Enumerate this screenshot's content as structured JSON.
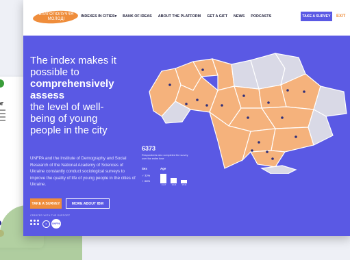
{
  "header": {
    "logo_text": "БЛАГОПОЛУЧЧЯ МОЛОДІ",
    "nav": [
      {
        "label": "INDEXES IN CITIES",
        "has_dropdown": true
      },
      {
        "label": "BANK OF IDEAS"
      },
      {
        "label": "ABOUT THE PLATFORM"
      },
      {
        "label": "GET A GIFT"
      },
      {
        "label": "NEWS"
      },
      {
        "label": "PODCASTS"
      }
    ],
    "take_survey": "TAKE A SURVEY",
    "exit": "EXIT"
  },
  "hero": {
    "line1": "The index makes it",
    "line2": "possible to",
    "line3": "comprehensively",
    "line4": "assess",
    "line5": "the level of well-",
    "line6": "being of young",
    "line7": "people in the city",
    "description": "UNFPA and the Institute of Demography and Social Research of the National Academy of Sciences of Ukraine constantly conduct sociological surveys to improve the quality of life of young people in the cities of Ukraine.",
    "btn_survey": "TAKE A SURVEY",
    "btn_more": "MORE ABOUT IBM",
    "partners_label": "CREATED WITH THE SUPPORT",
    "partner_unfpa": "UNFPA"
  },
  "stats": {
    "respondents": "6373",
    "caption": "Respondents who completed the survey over the entire time",
    "sex_label": "Sex",
    "age_label": "Age",
    "male": "32%",
    "female": "68%",
    "age_groups": [
      {
        "label": "14-17",
        "share": 0.75
      },
      {
        "label": "18-24",
        "share": 0.45
      },
      {
        "label": "25-34",
        "share": 0.3
      }
    ]
  },
  "colors": {
    "brand_purple": "#5a59e4",
    "accent_orange": "#ef8d3b",
    "map_highlight": "#f5b27c",
    "map_muted": "#d9d9e6"
  }
}
